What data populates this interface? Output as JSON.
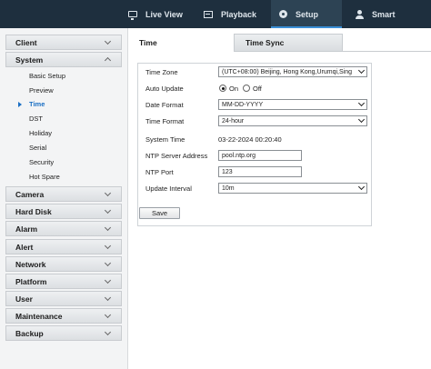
{
  "topnav": {
    "items": [
      {
        "label": "Live View",
        "icon": "monitor-icon"
      },
      {
        "label": "Playback",
        "icon": "film-icon"
      },
      {
        "label": "Setup",
        "icon": "gear-icon",
        "active": true
      },
      {
        "label": "Smart",
        "icon": "person-icon"
      }
    ]
  },
  "sidebar": {
    "sections": [
      {
        "label": "Client",
        "expanded": false
      },
      {
        "label": "System",
        "expanded": true,
        "items": [
          "Basic Setup",
          "Preview",
          "Time",
          "DST",
          "Holiday",
          "Serial",
          "Security",
          "Hot Spare"
        ],
        "active_item": "Time"
      },
      {
        "label": "Camera",
        "expanded": false
      },
      {
        "label": "Hard Disk",
        "expanded": false
      },
      {
        "label": "Alarm",
        "expanded": false
      },
      {
        "label": "Alert",
        "expanded": false
      },
      {
        "label": "Network",
        "expanded": false
      },
      {
        "label": "Platform",
        "expanded": false
      },
      {
        "label": "User",
        "expanded": false
      },
      {
        "label": "Maintenance",
        "expanded": false
      },
      {
        "label": "Backup",
        "expanded": false
      }
    ]
  },
  "tabs": [
    {
      "label": "Time",
      "active": true
    },
    {
      "label": "Time Sync",
      "active": false
    }
  ],
  "form": {
    "time_zone": {
      "label": "Time Zone",
      "value": "(UTC+08:00) Beijing, Hong Kong,Urumqi,Sing"
    },
    "auto_update": {
      "label": "Auto Update",
      "on_label": "On",
      "off_label": "Off",
      "selected": "On"
    },
    "date_format": {
      "label": "Date Format",
      "value": "MM-DD-YYYY"
    },
    "time_format": {
      "label": "Time Format",
      "value": "24-hour"
    },
    "system_time": {
      "label": "System Time",
      "value": "03-22-2024 00:20:40"
    },
    "ntp_server": {
      "label": "NTP Server Address",
      "value": "pool.ntp.org"
    },
    "ntp_port": {
      "label": "NTP Port",
      "value": "123"
    },
    "update_interval": {
      "label": "Update Interval",
      "value": "10m"
    }
  },
  "save_label": "Save",
  "colors": {
    "topbar": "#1e2f3e",
    "accent": "#3a8fd6",
    "active_link": "#1a6fc4"
  }
}
